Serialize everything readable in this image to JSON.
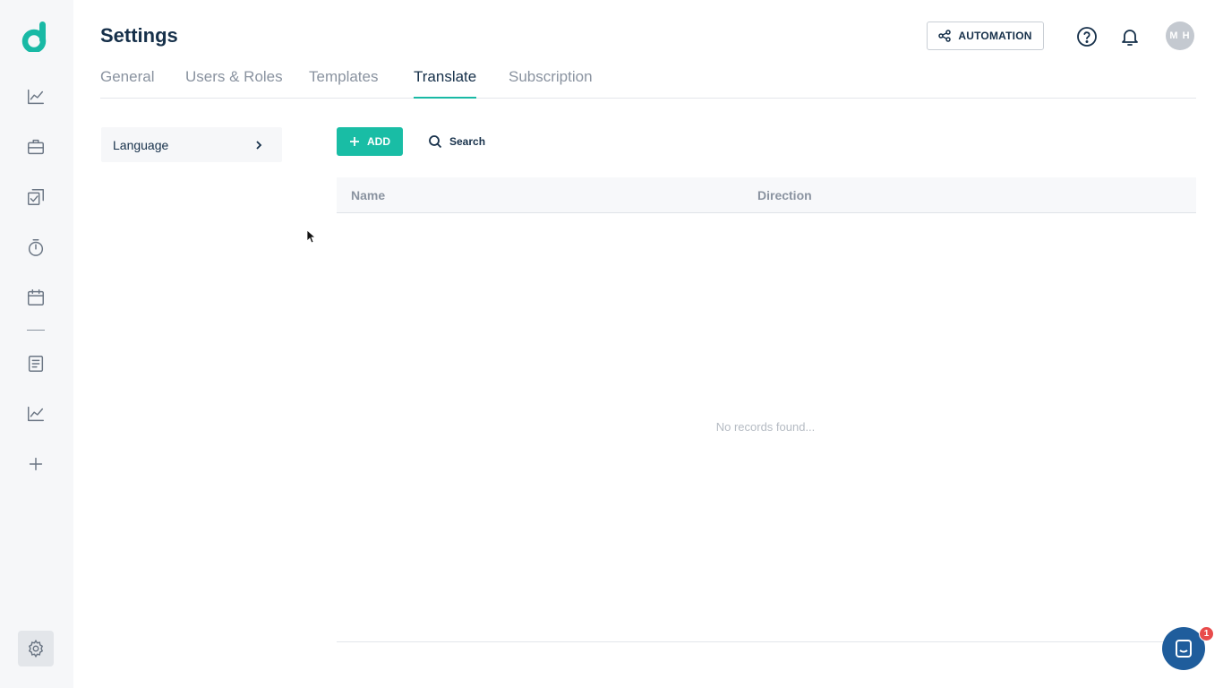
{
  "app": {
    "logo_letter": "d",
    "brand_color": "#19b9a5"
  },
  "header": {
    "title": "Settings",
    "automation_label": "AUTOMATION",
    "avatar_initials": "M H"
  },
  "tabs": [
    {
      "label": "General",
      "active": false
    },
    {
      "label": "Users & Roles",
      "active": false
    },
    {
      "label": "Templates",
      "active": false
    },
    {
      "label": "Translate",
      "active": true
    },
    {
      "label": "Subscription",
      "active": false
    }
  ],
  "sidebar": {
    "icons": [
      "chart-line-icon",
      "briefcase-icon",
      "checklist-icon",
      "stopwatch-icon",
      "calendar-icon",
      "document-icon",
      "analytics-icon",
      "plus-icon"
    ],
    "settings_icon": "gear-icon"
  },
  "left_menu": {
    "items": [
      {
        "label": "Language"
      }
    ]
  },
  "toolbar": {
    "add_label": "ADD",
    "search_label": "Search"
  },
  "table": {
    "columns": [
      "Name",
      "Direction"
    ],
    "rows": [],
    "empty_message": "No records found..."
  },
  "chat": {
    "badge_count": "1"
  }
}
